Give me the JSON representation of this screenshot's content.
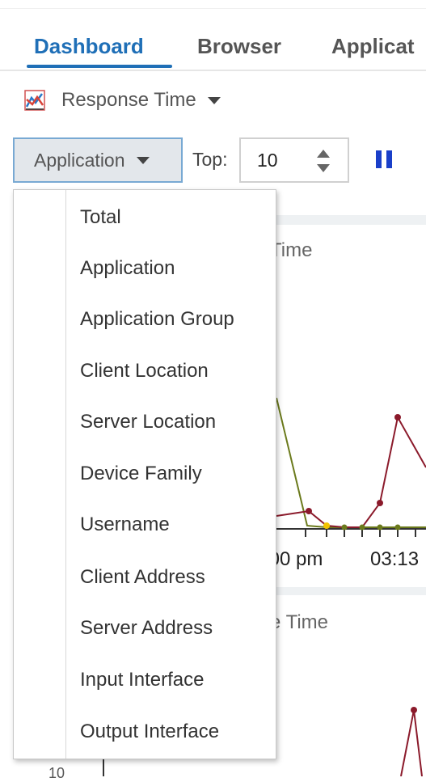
{
  "tabs": [
    {
      "label": "Dashboard",
      "active": true
    },
    {
      "label": "Browser",
      "active": false
    },
    {
      "label": "Applicat",
      "active": false
    }
  ],
  "toolbar": {
    "report_label": "Response Time",
    "report_icon": "response-time-chart-icon",
    "group_by_label": "Application",
    "top_label": "Top:",
    "top_value": "10",
    "pause_icon": "pause-icon"
  },
  "background_chart": {
    "title1_fragment": "Time",
    "title2_fragment": "e Time",
    "x_ticks": [
      ":00 pm",
      "03:13"
    ],
    "y_fragment": "10",
    "colors": {
      "series_a": "#8b1a2b",
      "series_b": "#6b7a1c",
      "series_c": "#f2c300"
    }
  },
  "menu": {
    "items": [
      "Total",
      "Application",
      "Application Group",
      "Client Location",
      "Server Location",
      "Device Family",
      "Username",
      "Client Address",
      "Server Address",
      "Input Interface",
      "Output Interface"
    ]
  },
  "colors": {
    "accent": "#1f6fb7",
    "button_border": "#78a9d3",
    "button_bg": "#e3e7eb",
    "pause": "#1a3fc9"
  }
}
